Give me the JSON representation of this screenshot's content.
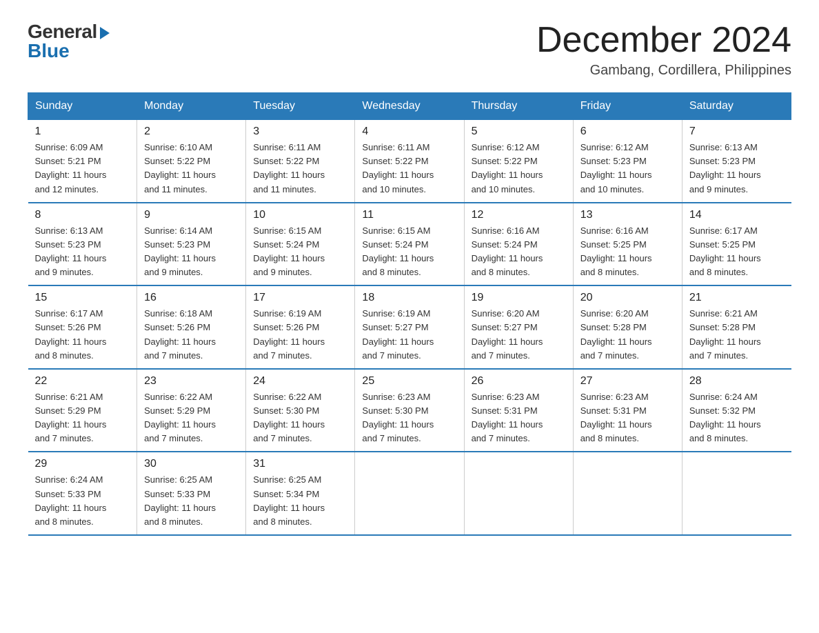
{
  "logo": {
    "general": "General",
    "blue": "Blue"
  },
  "title": "December 2024",
  "location": "Gambang, Cordillera, Philippines",
  "days_of_week": [
    "Sunday",
    "Monday",
    "Tuesday",
    "Wednesday",
    "Thursday",
    "Friday",
    "Saturday"
  ],
  "weeks": [
    [
      {
        "day": "1",
        "sunrise": "6:09 AM",
        "sunset": "5:21 PM",
        "daylight": "11 hours and 12 minutes."
      },
      {
        "day": "2",
        "sunrise": "6:10 AM",
        "sunset": "5:22 PM",
        "daylight": "11 hours and 11 minutes."
      },
      {
        "day": "3",
        "sunrise": "6:11 AM",
        "sunset": "5:22 PM",
        "daylight": "11 hours and 11 minutes."
      },
      {
        "day": "4",
        "sunrise": "6:11 AM",
        "sunset": "5:22 PM",
        "daylight": "11 hours and 10 minutes."
      },
      {
        "day": "5",
        "sunrise": "6:12 AM",
        "sunset": "5:22 PM",
        "daylight": "11 hours and 10 minutes."
      },
      {
        "day": "6",
        "sunrise": "6:12 AM",
        "sunset": "5:23 PM",
        "daylight": "11 hours and 10 minutes."
      },
      {
        "day": "7",
        "sunrise": "6:13 AM",
        "sunset": "5:23 PM",
        "daylight": "11 hours and 9 minutes."
      }
    ],
    [
      {
        "day": "8",
        "sunrise": "6:13 AM",
        "sunset": "5:23 PM",
        "daylight": "11 hours and 9 minutes."
      },
      {
        "day": "9",
        "sunrise": "6:14 AM",
        "sunset": "5:23 PM",
        "daylight": "11 hours and 9 minutes."
      },
      {
        "day": "10",
        "sunrise": "6:15 AM",
        "sunset": "5:24 PM",
        "daylight": "11 hours and 9 minutes."
      },
      {
        "day": "11",
        "sunrise": "6:15 AM",
        "sunset": "5:24 PM",
        "daylight": "11 hours and 8 minutes."
      },
      {
        "day": "12",
        "sunrise": "6:16 AM",
        "sunset": "5:24 PM",
        "daylight": "11 hours and 8 minutes."
      },
      {
        "day": "13",
        "sunrise": "6:16 AM",
        "sunset": "5:25 PM",
        "daylight": "11 hours and 8 minutes."
      },
      {
        "day": "14",
        "sunrise": "6:17 AM",
        "sunset": "5:25 PM",
        "daylight": "11 hours and 8 minutes."
      }
    ],
    [
      {
        "day": "15",
        "sunrise": "6:17 AM",
        "sunset": "5:26 PM",
        "daylight": "11 hours and 8 minutes."
      },
      {
        "day": "16",
        "sunrise": "6:18 AM",
        "sunset": "5:26 PM",
        "daylight": "11 hours and 7 minutes."
      },
      {
        "day": "17",
        "sunrise": "6:19 AM",
        "sunset": "5:26 PM",
        "daylight": "11 hours and 7 minutes."
      },
      {
        "day": "18",
        "sunrise": "6:19 AM",
        "sunset": "5:27 PM",
        "daylight": "11 hours and 7 minutes."
      },
      {
        "day": "19",
        "sunrise": "6:20 AM",
        "sunset": "5:27 PM",
        "daylight": "11 hours and 7 minutes."
      },
      {
        "day": "20",
        "sunrise": "6:20 AM",
        "sunset": "5:28 PM",
        "daylight": "11 hours and 7 minutes."
      },
      {
        "day": "21",
        "sunrise": "6:21 AM",
        "sunset": "5:28 PM",
        "daylight": "11 hours and 7 minutes."
      }
    ],
    [
      {
        "day": "22",
        "sunrise": "6:21 AM",
        "sunset": "5:29 PM",
        "daylight": "11 hours and 7 minutes."
      },
      {
        "day": "23",
        "sunrise": "6:22 AM",
        "sunset": "5:29 PM",
        "daylight": "11 hours and 7 minutes."
      },
      {
        "day": "24",
        "sunrise": "6:22 AM",
        "sunset": "5:30 PM",
        "daylight": "11 hours and 7 minutes."
      },
      {
        "day": "25",
        "sunrise": "6:23 AM",
        "sunset": "5:30 PM",
        "daylight": "11 hours and 7 minutes."
      },
      {
        "day": "26",
        "sunrise": "6:23 AM",
        "sunset": "5:31 PM",
        "daylight": "11 hours and 7 minutes."
      },
      {
        "day": "27",
        "sunrise": "6:23 AM",
        "sunset": "5:31 PM",
        "daylight": "11 hours and 8 minutes."
      },
      {
        "day": "28",
        "sunrise": "6:24 AM",
        "sunset": "5:32 PM",
        "daylight": "11 hours and 8 minutes."
      }
    ],
    [
      {
        "day": "29",
        "sunrise": "6:24 AM",
        "sunset": "5:33 PM",
        "daylight": "11 hours and 8 minutes."
      },
      {
        "day": "30",
        "sunrise": "6:25 AM",
        "sunset": "5:33 PM",
        "daylight": "11 hours and 8 minutes."
      },
      {
        "day": "31",
        "sunrise": "6:25 AM",
        "sunset": "5:34 PM",
        "daylight": "11 hours and 8 minutes."
      },
      null,
      null,
      null,
      null
    ]
  ],
  "labels": {
    "sunrise": "Sunrise:",
    "sunset": "Sunset:",
    "daylight": "Daylight:"
  }
}
